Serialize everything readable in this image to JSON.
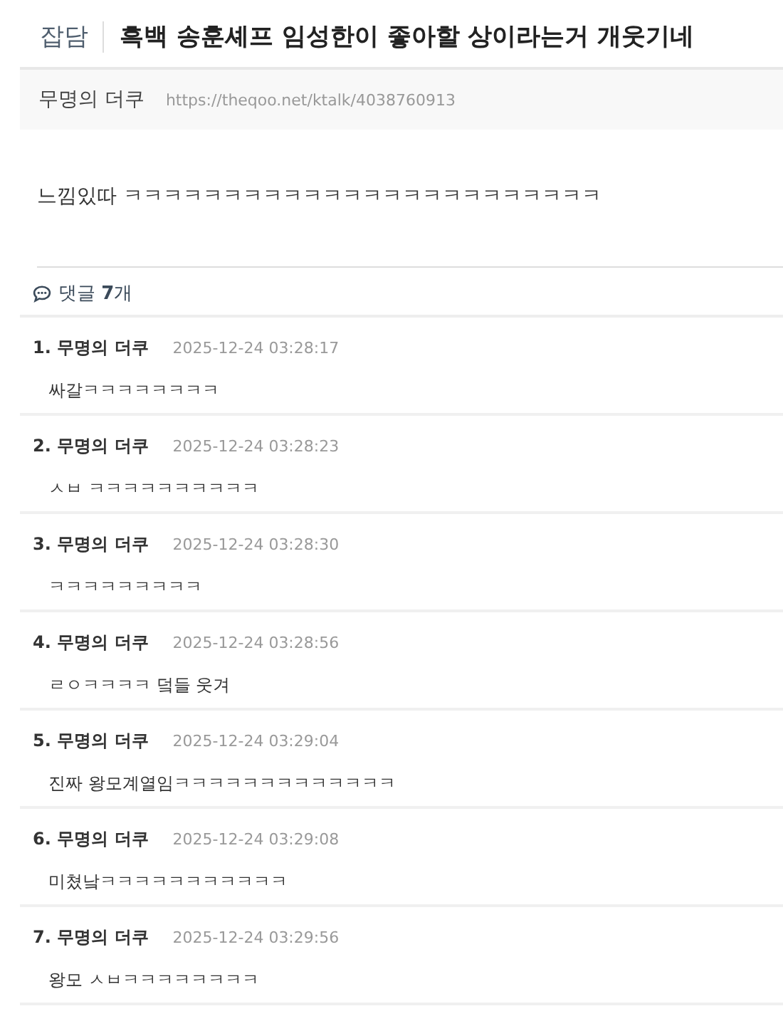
{
  "post": {
    "category": "잡담",
    "title": "흑백 송훈셰프 임성한이 좋아할 상이라는거 개웃기네",
    "author": "무명의 더쿠",
    "url": "https://theqoo.net/ktalk/4038760913",
    "body": "느낌있따 ㅋㅋㅋㅋㅋㅋㅋㅋㅋㅋㅋㅋㅋㅋㅋㅋㅋㅋㅋㅋㅋㅋㅋㅋ"
  },
  "comments_header": {
    "label": "댓글",
    "count": "7",
    "unit": "개"
  },
  "comments": [
    {
      "number": "1.",
      "author": "무명의 더쿠",
      "time": "2025-12-24 03:28:17",
      "text": "싸갈ㅋㅋㅋㅋㅋㅋㅋㅋ"
    },
    {
      "number": "2.",
      "author": "무명의 더쿠",
      "time": "2025-12-24 03:28:23",
      "text": "ㅅㅂ ㅋㅋㅋㅋㅋㅋㅋㅋㅋㅋ"
    },
    {
      "number": "3.",
      "author": "무명의 더쿠",
      "time": "2025-12-24 03:28:30",
      "text": "ㅋㅋㅋㅋㅋㅋㅋㅋㅋ"
    },
    {
      "number": "4.",
      "author": "무명의 더쿠",
      "time": "2025-12-24 03:28:56",
      "text": "ㄹㅇㅋㅋㅋㅋ 덬들 웃겨"
    },
    {
      "number": "5.",
      "author": "무명의 더쿠",
      "time": "2025-12-24 03:29:04",
      "text": "진짜 왕모계열임ㅋㅋㅋㅋㅋㅋㅋㅋㅋㅋㅋㅋㅋ"
    },
    {
      "number": "6.",
      "author": "무명의 더쿠",
      "time": "2025-12-24 03:29:08",
      "text": "미쳤낰ㅋㅋㅋㅋㅋㅋㅋㅋㅋㅋㅋ"
    },
    {
      "number": "7.",
      "author": "무명의 더쿠",
      "time": "2025-12-24 03:29:56",
      "text": "왕모 ㅅㅂㅋㅋㅋㅋㅋㅋㅋㅋ"
    }
  ]
}
